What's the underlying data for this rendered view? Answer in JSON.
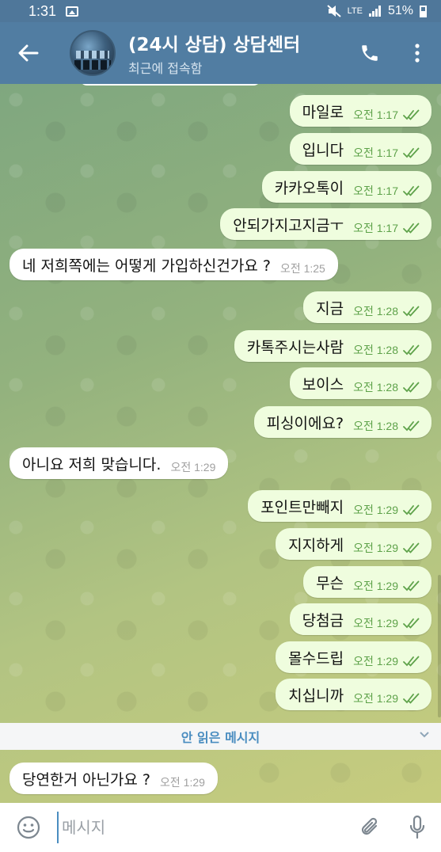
{
  "status_bar": {
    "time": "1:31",
    "network": "LTE",
    "battery": "51%"
  },
  "header": {
    "title": "(24시 상담) 상담센터",
    "subtitle": "최근에 접속함"
  },
  "messages": [
    {
      "dir": "out",
      "text": "마일로",
      "time": "오전 1:17"
    },
    {
      "dir": "out",
      "text": "입니다",
      "time": "오전 1:17"
    },
    {
      "dir": "out",
      "text": "카카오톡이",
      "time": "오전 1:17"
    },
    {
      "dir": "out",
      "text": "안되가지고지금ㅜ",
      "time": "오전 1:17"
    },
    {
      "dir": "in",
      "text": "네 저희쪽에는 어떻게 가입하신건가요 ?",
      "time": "오전 1:25"
    },
    {
      "dir": "out",
      "text": "지금",
      "time": "오전 1:28"
    },
    {
      "dir": "out",
      "text": "카톡주시는사람",
      "time": "오전 1:28"
    },
    {
      "dir": "out",
      "text": "보이스",
      "time": "오전 1:28"
    },
    {
      "dir": "out",
      "text": "피싱이에요?",
      "time": "오전 1:28"
    },
    {
      "dir": "in",
      "text": "아니요 저희 맞습니다.",
      "time": "오전 1:29"
    },
    {
      "dir": "out",
      "text": "포인트만빼지",
      "time": "오전 1:29"
    },
    {
      "dir": "out",
      "text": "지지하게",
      "time": "오전 1:29"
    },
    {
      "dir": "out",
      "text": "무슨",
      "time": "오전 1:29"
    },
    {
      "dir": "out",
      "text": "당첨금",
      "time": "오전 1:29"
    },
    {
      "dir": "out",
      "text": "몰수드립",
      "time": "오전 1:29"
    },
    {
      "dir": "out",
      "text": "치십니까",
      "time": "오전 1:29"
    },
    {
      "dir": "in",
      "text": "당연한거 아닌가요 ?",
      "time": "오전 1:29"
    }
  ],
  "unread_label": "안 읽은 메시지",
  "input": {
    "placeholder": "메시지"
  },
  "colors": {
    "header": "#517da2",
    "outgoing_bubble": "#effdde",
    "incoming_bubble": "#ffffff",
    "check_color": "#5ea24a",
    "accent": "#4a8dc0"
  },
  "icons": [
    "back-arrow-icon",
    "phone-icon",
    "more-vert-icon",
    "emoji-icon",
    "attach-icon",
    "mic-icon",
    "double-check-icon",
    "chevron-down-icon"
  ]
}
